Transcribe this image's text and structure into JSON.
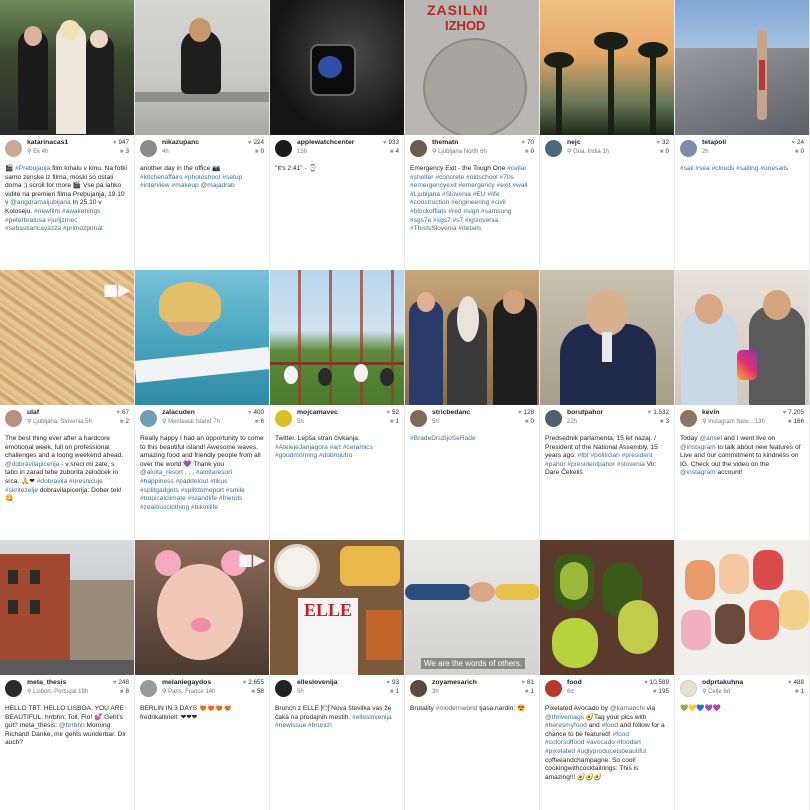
{
  "posts": [
    {
      "user": "katarinacas1",
      "location": "Ek",
      "time": "4h",
      "likes": "947",
      "comments": "3",
      "caption": "🎬 #Prebujanja film kmalu v kinu. Na fotki samo zenske iz filma, moski so ostali doma ;) scroll for more 🎬 Vse pa lahko vidite na premieri filma Prebujanja, 19.10 v @angdramaljubljana In 25.10 v Koloseju. #newfilm #awakenings #peterbratusa #jurijzrnec #sebastiancavazza #primozpirnat",
      "avatar": "#c9a98f"
    },
    {
      "user": "nikazupanc",
      "location": "",
      "time": "4h",
      "likes": "224",
      "comments": "0",
      "caption": "another day in the office 📷 #kitchenaffairs #photoshoot #setup #interview #makeup @majadrab",
      "avatar": "#8a8a8a"
    },
    {
      "user": "applewatchcenter",
      "location": "",
      "time": "15h",
      "likes": "933",
      "comments": "4",
      "caption": "\"It's 2:41\" - ⌚",
      "avatar": "#1a1a1a"
    },
    {
      "user": "thematn",
      "location": "Ljubljana North",
      "time": "6h",
      "likes": "70",
      "comments": "0",
      "caption": "Emergency Exit - the Tough One #cellar #shelter #concrete #oldschool #70s #emergencyexit #emergency #exit #wall #Ljubljana #Slovenia #EU #life #construction #engineering #civil #blockoffiats #red #sign #samsung #sgs7e #sgs7 #s7 #igslovenia #ThisIsSlovenia #details",
      "avatar": "#6d5c4c"
    },
    {
      "user": "nejc",
      "location": "Goa, India",
      "time": "1h",
      "likes": "32",
      "comments": "0",
      "caption": "",
      "avatar": "#4a6a7c"
    },
    {
      "user": "tetapoli",
      "location": "",
      "time": "2h",
      "likes": "24",
      "comments": "0",
      "caption": "#sail #sea #clouds #sailing #onesails",
      "avatar": "#7b8fa6"
    },
    {
      "user": "ulaf",
      "location": "Ljubljana, Slovenia",
      "time": "5h",
      "likes": "67",
      "comments": "2",
      "caption": "The best thing ever after a hardcore emotional week, full on professional challenges and a loong weekend ahead. @dobravilapicerija - v sreci mi zate, s tabo in zarad tebe zuborita zelodcek in srca. 🙏❤ #dobravila #uresnicuje #skritezelje dobravilapicerija: Dober tek! 😋",
      "avatar": "#b8927a"
    },
    {
      "user": "zalacuden",
      "location": "Mentawai Island",
      "time": "7h",
      "likes": "400",
      "comments": "6",
      "caption": "Really happy I had an opportunity to come to this beautiful island! Awesome waves, amazing food and friendly people from all over the world 💜 Thank you @aloita_resort . . . #aloitaresort #happiness #paddelout #tikus #splitgadgets #splitdomeport #smile #tropicalclimate #islandlife #friends #zealousclothing #bikinilife",
      "avatar": "#6fa0b5"
    },
    {
      "user": "mojcamavec",
      "location": "",
      "time": "5h",
      "likes": "52",
      "comments": "1",
      "caption": "Twitter. Lepša stran čivkanja. #AtelejeJanjagora #art #ceramics #goodmorning #dobrojutro",
      "avatar": "#d8c020"
    },
    {
      "user": "stricbedanc",
      "location": "",
      "time": "5h",
      "likes": "128",
      "comments": "0",
      "caption": "#BradeDružijoSeRade",
      "avatar": "#7d6a58"
    },
    {
      "user": "borutpahor",
      "location": "",
      "time": "22h",
      "likes": "1.532",
      "comments": "3",
      "caption": "Predsednik parlamenta, 15 let nazaj. / President of the National Assembly, 15 years ago. #tbt #politician #president #pahor #presidentpahor #slovenia Vir: Dare Čekeliš",
      "avatar": "#506070"
    },
    {
      "user": "kevin",
      "location": "Instagram New...",
      "time": "13h",
      "likes": "7.205",
      "comments": "166",
      "caption": "Today @ansel and I went live on @instagram to talk about new features of Live and our commitment to kindness on IG. Check out the video on the @instagram account!",
      "avatar": "#8c7560"
    },
    {
      "user": "meta_thesis",
      "location": "Lisbon, Portugal",
      "time": "19h",
      "likes": "248",
      "comments": "8",
      "caption": "HELLO TBT. HELLO LISBOA. YOU ARE BEAUTIFUL. hrrbhn: Toll, Flo! 💕 Geht's gut? meta_thesis: @hrrbhn Morning Richard! Danke, mir gehts wunderbar. Dir auch?",
      "avatar": "#2a2a2a"
    },
    {
      "user": "melaniegaydos",
      "location": "Paris, France",
      "time": "14h",
      "likes": "2.655",
      "comments": "58",
      "caption": "BERLIN IN 3 DAYS 😻😻😻😻 fredrikaltinell: ❤❤❤",
      "avatar": "#9a9a9a"
    },
    {
      "user": "elleslovenija",
      "location": "",
      "time": "5h",
      "likes": "93",
      "comments": "1",
      "caption": "Brunch z ELLE 🍽 Nova številka vas že čaka na prodajnih mestih. #elleslovenija #newissue #brunch",
      "avatar": "#222222"
    },
    {
      "user": "zoyamesarich",
      "location": "",
      "time": "3h",
      "likes": "81",
      "comments": "1",
      "caption": "Brutality #modernworld tjasa.nardin: 😍",
      "avatar": "#5a4a40"
    },
    {
      "user": "food",
      "location": "",
      "time": "6d",
      "likes": "10.589",
      "comments": "195",
      "caption": "Pixelated Avocado by @kamanchi via @thrivemags 🥑Tag your pics with #heresmyfood and #food and follow for a chance to be featured! #food #colorsoffood #avocado #foodart #pixelated #uglyproduceisbeautiful coffeeandchampagne: So cool! cookingwithcocktailrings: This is amazing!!! 🥑🥑🥑",
      "avatar": "#b5382a"
    },
    {
      "user": "odprtakuhna",
      "location": "Celje",
      "time": "6d",
      "likes": "488",
      "comments": "1",
      "caption": "💚💛💙💜💜",
      "avatar": "#e8e0d0"
    }
  ],
  "overlay_text": {
    "zoya_caption_overlay": "We are the words of others."
  },
  "icons": {
    "location": "location-pin-icon",
    "like": "heart-icon",
    "comment": "comment-icon",
    "video": "video-camera-icon"
  },
  "colors": {
    "link": "#3f729b",
    "text": "#262626",
    "muted": "#7a7a7a"
  }
}
